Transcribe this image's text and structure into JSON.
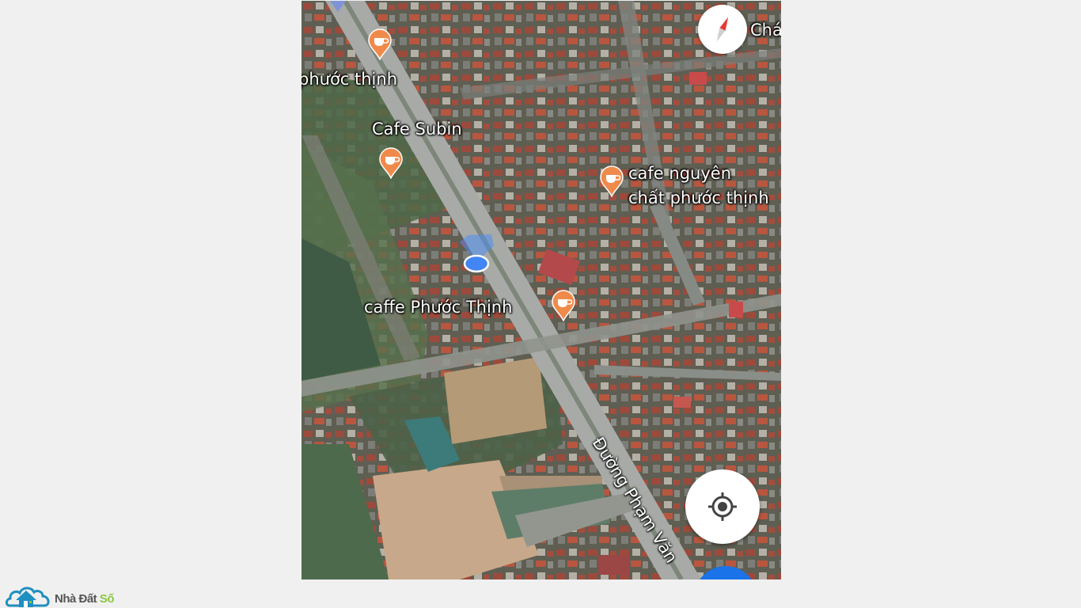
{
  "map": {
    "type": "satellite",
    "places": [
      {
        "name": "phước thịnh",
        "kind": "cafe",
        "pin": false
      },
      {
        "name": "Cafe Subin",
        "kind": "cafe",
        "pin": true
      },
      {
        "name": "cafe nguyên\nchất phước thịnh",
        "kind": "cafe",
        "pin": true
      },
      {
        "name": "caffe Phước Thịnh",
        "kind": "cafe",
        "pin": true
      }
    ],
    "road_label": "Đường Phạm Văn",
    "corner_label": "Chá",
    "colors": {
      "pin": "#f08a4b",
      "location": "#4285f4",
      "fab": "#1a73e8"
    }
  },
  "controls": {
    "compass_icon": "compass-icon",
    "locate_icon": "my-location-icon"
  },
  "logo": {
    "brand_part1": "Nhà Đất ",
    "brand_part2": "Số",
    "colors": {
      "brand_dark": "#555555",
      "brand_green": "#8dc63f",
      "house": "#1f8fc0"
    }
  }
}
